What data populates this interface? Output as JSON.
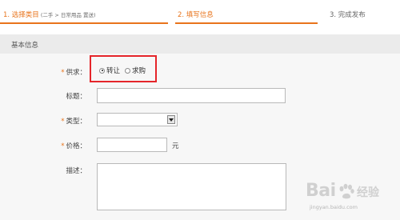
{
  "steps": {
    "step1_label": "1. 选择类目",
    "step1_sub": "(二手 > 日常用品 置送)",
    "step2_label": "2. 填写信息",
    "step3_label": "3. 完成发布"
  },
  "section": {
    "title": "基本信息"
  },
  "form": {
    "supply_label": "供求：",
    "supply_options": [
      "转让",
      "求购"
    ],
    "supply_selected": "转让",
    "title_label": "标题：",
    "title_value": "",
    "type_label": "类型：",
    "type_value": "",
    "price_label": "价格：",
    "price_value": "",
    "price_unit": "元",
    "desc_label": "描述：",
    "desc_value": "",
    "required_mark": "*"
  },
  "watermark": {
    "brand": "Bai",
    "product": "经验",
    "url": "jingyan.baidu.com"
  },
  "colors": {
    "accent": "#e8741c",
    "highlight": "#e5252a",
    "section_bg": "#ebebeb",
    "form_bg": "#f7f7f7"
  }
}
